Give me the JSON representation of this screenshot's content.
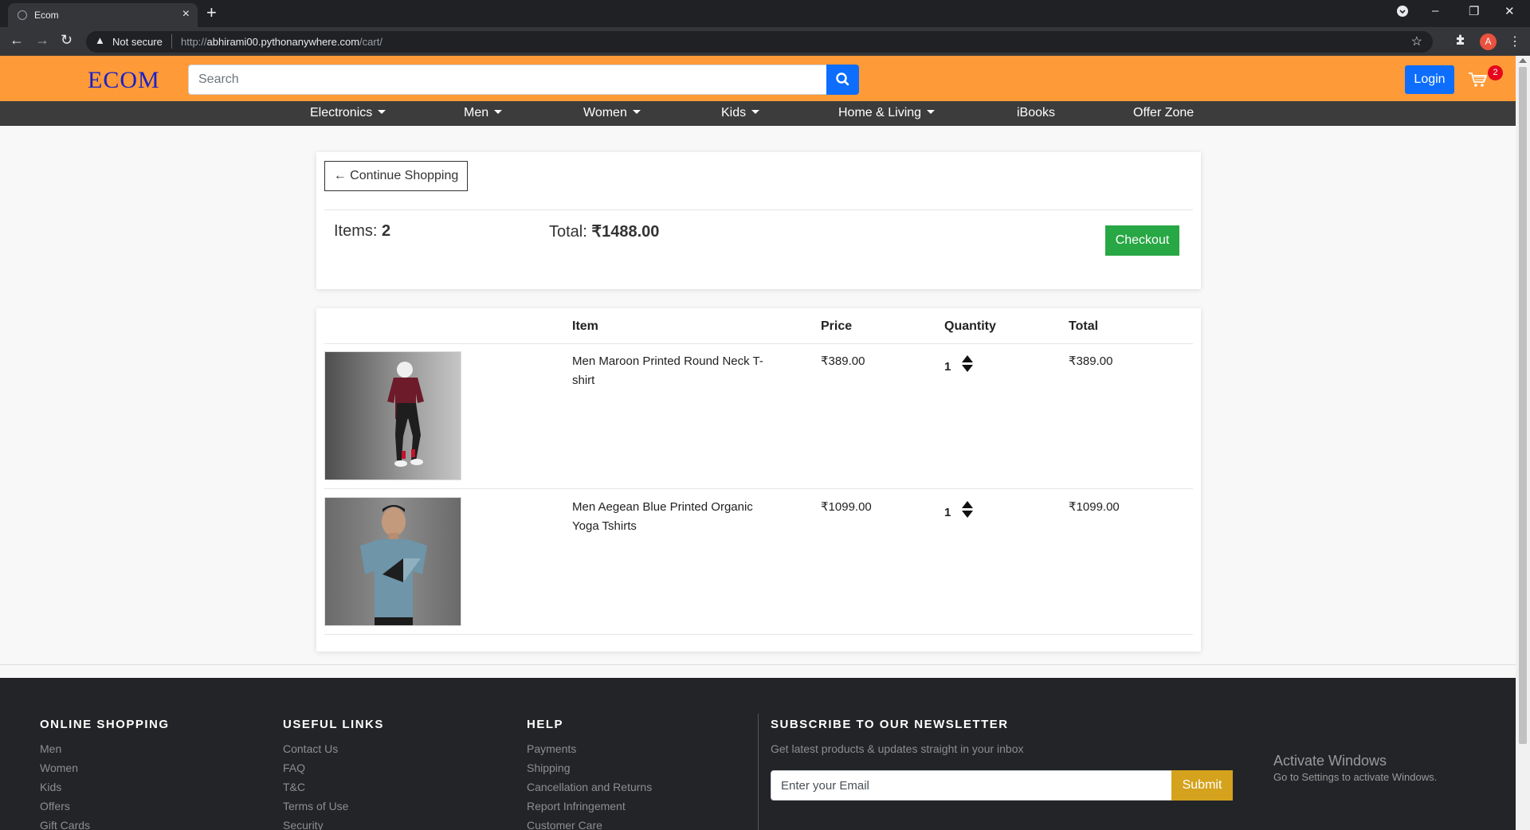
{
  "browser": {
    "tab_title": "Ecom",
    "not_secure": "Not secure",
    "url_scheme": "http://",
    "url_host": "abhirami00.pythonanywhere.com",
    "url_path": "/cart/",
    "profile_initial": "A"
  },
  "header": {
    "logo": "ECOM",
    "search_placeholder": "Search",
    "login_label": "Login",
    "cart_count": "2"
  },
  "nav": {
    "items": [
      {
        "label": "Electronics"
      },
      {
        "label": "Men"
      },
      {
        "label": "Women"
      },
      {
        "label": "Kids"
      },
      {
        "label": "Home & Living"
      },
      {
        "label": "iBooks"
      },
      {
        "label": "Offer Zone"
      }
    ]
  },
  "summary": {
    "continue_label": "← Continue Shopping",
    "items_label": "Items:",
    "items_value": "2",
    "total_label": "Total:",
    "total_value": "₹1488.00",
    "checkout_label": "Checkout"
  },
  "table": {
    "headers": {
      "item": "Item",
      "price": "Price",
      "quantity": "Quantity",
      "total": "Total"
    },
    "rows": [
      {
        "name": "Men Maroon Printed Round Neck T-shirt",
        "price": "₹389.00",
        "qty": "1",
        "total": "₹389.00"
      },
      {
        "name": "Men Aegean Blue Printed Organic Yoga Tshirts",
        "price": "₹1099.00",
        "qty": "1",
        "total": "₹1099.00"
      }
    ]
  },
  "footer": {
    "online_shopping": {
      "title": "ONLINE SHOPPING",
      "links": [
        "Men",
        "Women",
        "Kids",
        "Offers",
        "Gift Cards"
      ]
    },
    "useful_links": {
      "title": "USEFUL LINKS",
      "links": [
        "Contact Us",
        "FAQ",
        "T&C",
        "Terms of Use",
        "Security"
      ]
    },
    "help": {
      "title": "HELP",
      "links": [
        "Payments",
        "Shipping",
        "Cancellation and Returns",
        "Report Infringement",
        "Customer Care"
      ]
    },
    "newsletter": {
      "title": "SUBSCRIBE TO OUR NEWSLETTER",
      "subtitle": "Get latest products & updates straight in your inbox",
      "email_placeholder": "Enter your Email",
      "submit_label": "Submit"
    }
  },
  "os_overlay": {
    "title": "Activate Windows",
    "subtitle": "Go to Settings to activate Windows."
  },
  "colors": {
    "header_bg": "#fe9a37",
    "nav_bg": "#3c3c3c",
    "checkout_green": "#28a745",
    "primary_blue": "#0d6efd",
    "submit_gold": "#d4a21c",
    "footer_bg": "#232427"
  }
}
